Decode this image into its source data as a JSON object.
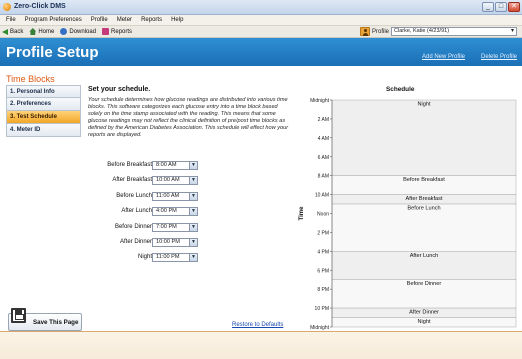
{
  "window": {
    "title": "Zero-Click DMS"
  },
  "menu": [
    "File",
    "Program Preferences",
    "Profile",
    "Meter",
    "Reports",
    "Help"
  ],
  "toolbar": {
    "back": "Back",
    "home": "Home",
    "download": "Download",
    "reports": "Reports",
    "profile_label": "Profile",
    "profile_value": "Clarke, Katie (4/23/91)"
  },
  "header": {
    "title": "Profile Setup",
    "add_new": "Add New Profile",
    "delete": "Delete Profile"
  },
  "nav": {
    "title": "Time Blocks",
    "items": [
      "1. Personal Info",
      "2. Preferences",
      "3. Test Schedule",
      "4. Meter ID"
    ],
    "active_index": 2
  },
  "schedule": {
    "heading": "Set your schedule.",
    "description": "Your schedule determines how glucose readings are distributed into various time blocks.  This software categorizes each glucose entry into a time block based solely on the time stamp associated with the reading.  This means that some glucose readings may not reflect the clinical definition of pre/post time blocks as defined by the American Diabetes Association. This schedule will effect how your reports are displayed.",
    "rows": [
      {
        "label": "Before Breakfast",
        "value": "8:00 AM"
      },
      {
        "label": "After Breakfast",
        "value": "10:00 AM"
      },
      {
        "label": "Before Lunch",
        "value": "11:00 AM"
      },
      {
        "label": "After Lunch",
        "value": "4:00 PM"
      },
      {
        "label": "Before Dinner",
        "value": "7:00 PM"
      },
      {
        "label": "After Dinner",
        "value": "10:00 PM"
      },
      {
        "label": "Night",
        "value": "11:00 PM"
      }
    ]
  },
  "buttons": {
    "save": "Save This Page",
    "restore": "Restore to Defaults"
  },
  "chart_data": {
    "type": "table",
    "title": "Schedule",
    "ylabel": "Time",
    "tick_labels": [
      "Midnight",
      "2 AM",
      "4 AM",
      "6 AM",
      "8 AM",
      "10 AM",
      "Noon",
      "2 PM",
      "4 PM",
      "6 PM",
      "8 PM",
      "10 PM",
      "Midnight"
    ],
    "blocks": [
      {
        "name": "Night",
        "start": 0,
        "end": 8
      },
      {
        "name": "Before Breakfast",
        "start": 8,
        "end": 10
      },
      {
        "name": "After Breakfast",
        "start": 10,
        "end": 11
      },
      {
        "name": "Before Lunch",
        "start": 11,
        "end": 16
      },
      {
        "name": "After Lunch",
        "start": 16,
        "end": 19
      },
      {
        "name": "Before Dinner",
        "start": 19,
        "end": 22
      },
      {
        "name": "After Dinner",
        "start": 22,
        "end": 23
      },
      {
        "name": "Night",
        "start": 23,
        "end": 24
      }
    ],
    "colors": {
      "band": "#efefef",
      "band_alt": "#f8f8f8",
      "line": "#b8b8b8"
    }
  }
}
